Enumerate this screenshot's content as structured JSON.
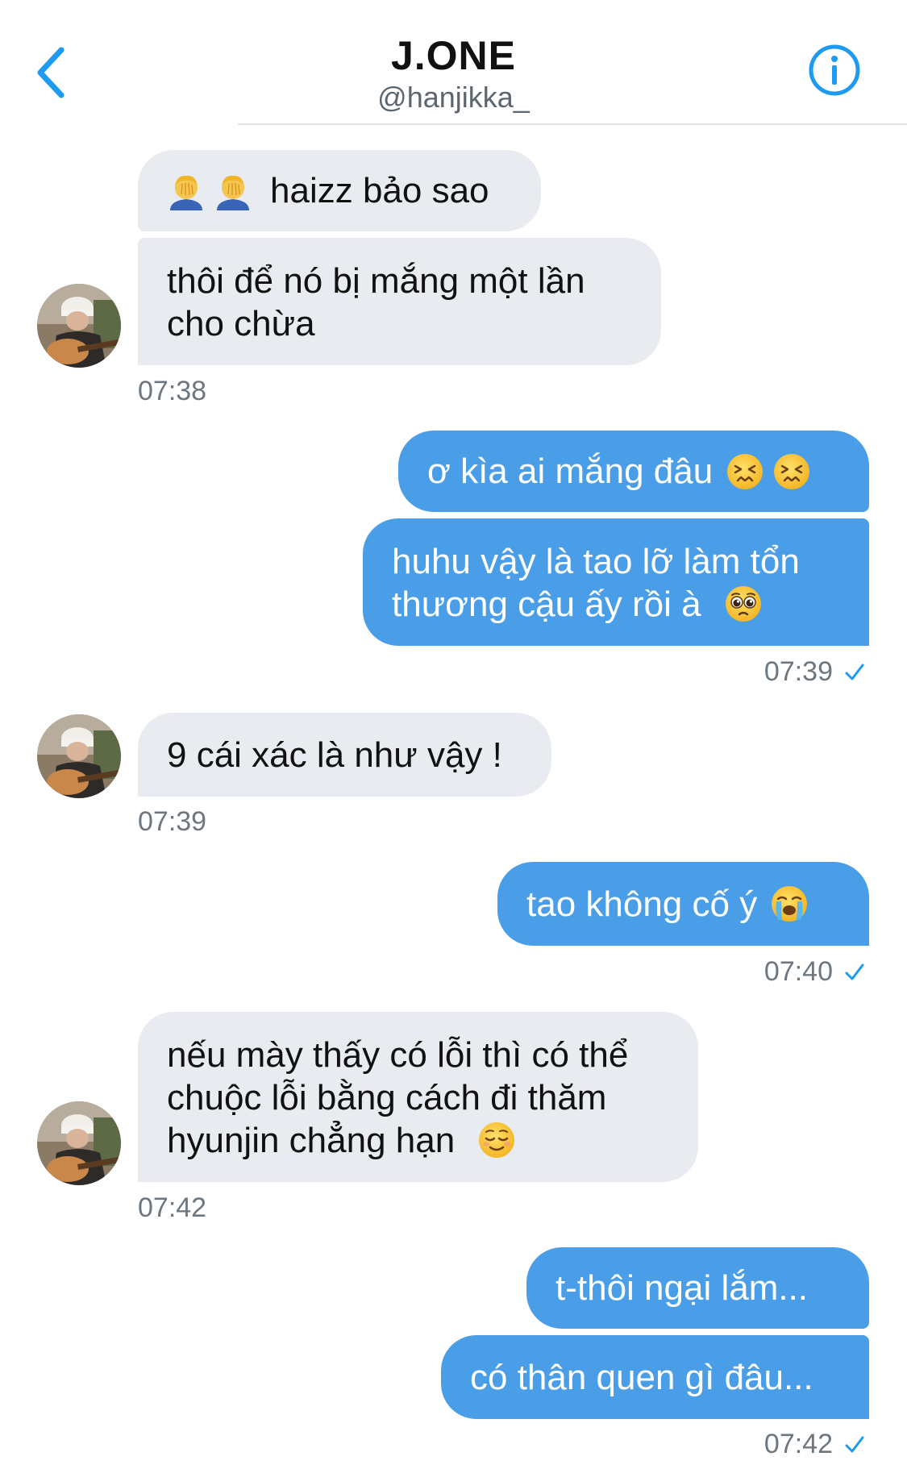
{
  "header": {
    "name": "J.ONE",
    "handle": "@hanjikka_"
  },
  "colors": {
    "accent": "#1d9bf0",
    "sent_bubble": "#4a9ee7",
    "received_bubble": "#e8ebef"
  },
  "messages": [
    {
      "text": "haizz bảo sao",
      "emoji": "facepalm x2"
    },
    {
      "line1": "thôi để nó bị mắng một lần",
      "line2": "cho chừa"
    },
    {
      "time": "07:38"
    },
    {
      "text": "ơ kìa ai mắng đâu",
      "emoji": "confounded face x2"
    },
    {
      "line1": "huhu vậy là tao lỡ làm tổn",
      "line2": "thương cậu ấy rồi à",
      "emoji": "pleading face"
    },
    {
      "time": "07:39"
    },
    {
      "text": "9 cái xác là như vậy !"
    },
    {
      "time": "07:39"
    },
    {
      "text": "tao không cố ý",
      "emoji": "loudly crying face"
    },
    {
      "time": "07:40"
    },
    {
      "line1": "nếu mày thấy có lỗi thì có thể",
      "line2": "chuộc lỗi bằng cách đi thăm",
      "line3": "hyunjin chẳng hạn",
      "emoji": "relieved face"
    },
    {
      "time": "07:42"
    },
    {
      "text": "t-thôi ngại lắm..."
    },
    {
      "text": "có thân quen gì đâu..."
    },
    {
      "time": "07:42"
    }
  ]
}
